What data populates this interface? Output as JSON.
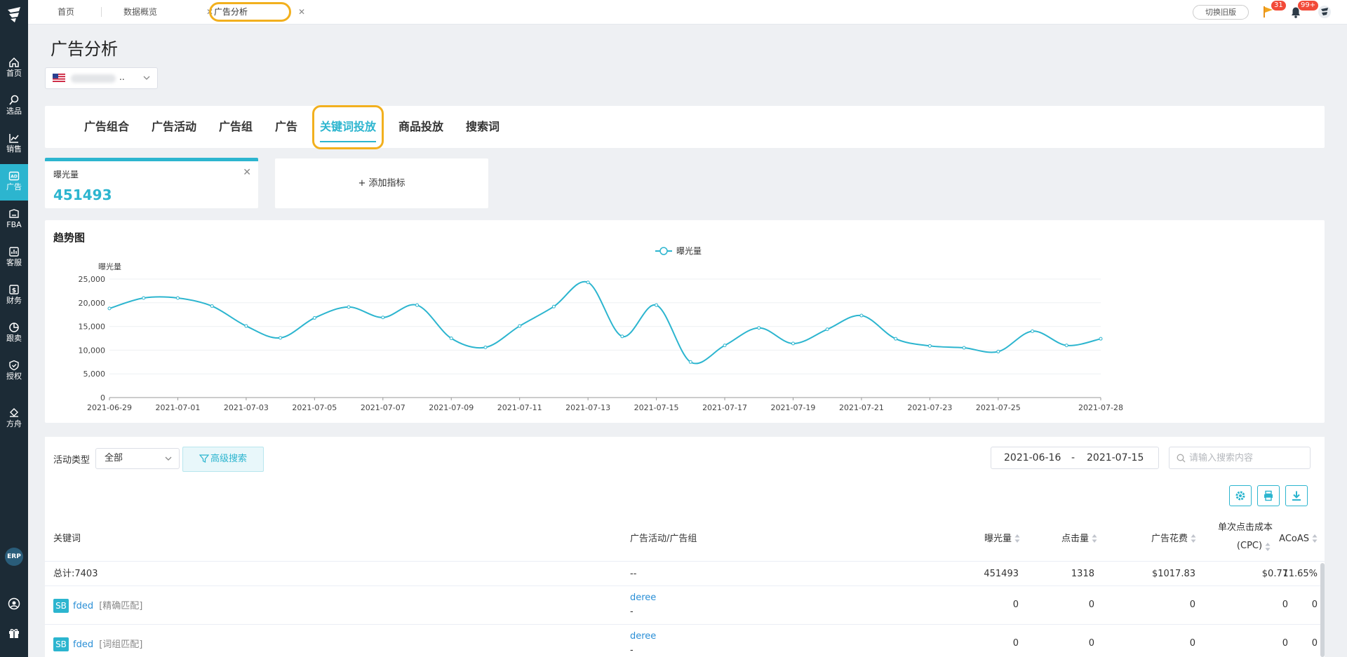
{
  "nav": {
    "items": [
      {
        "label": "首页",
        "icon": "home-icon",
        "active": false
      },
      {
        "label": "选品",
        "icon": "search-icon",
        "active": false
      },
      {
        "label": "销售",
        "icon": "chart-line-icon",
        "active": false
      },
      {
        "label": "广告",
        "icon": "ad-icon",
        "active": true
      },
      {
        "label": "FBA",
        "icon": "box-icon",
        "active": false
      },
      {
        "label": "客服",
        "icon": "bar-chart-icon",
        "active": false
      },
      {
        "label": "财务",
        "icon": "dollar-icon",
        "active": false
      },
      {
        "label": "跟卖",
        "icon": "pie-chart-icon",
        "active": false
      },
      {
        "label": "授权",
        "icon": "shield-icon",
        "active": false
      },
      {
        "label": "方舟",
        "icon": "ark-icon",
        "active": false
      }
    ],
    "erp_label": "ERP"
  },
  "topbar": {
    "tabs": [
      "首页",
      "数据概览",
      "广告分析"
    ],
    "old_version": "切换旧版",
    "flag_count": "31",
    "bell_count": "99+"
  },
  "page": {
    "title": "广告分析",
    "shop_suffix": ".."
  },
  "subtabs": [
    "广告组合",
    "广告活动",
    "广告组",
    "广告",
    "关键词投放",
    "商品投放",
    "搜索词"
  ],
  "metric": {
    "name": "曝光量",
    "value": "451493",
    "close": "✕"
  },
  "add_metric": "+ 添加指标",
  "trend": {
    "title": "趋势图"
  },
  "chart_data": {
    "type": "line",
    "title": "",
    "legend": "top-center",
    "ylabel": "曝光量",
    "ylim": [
      0,
      25000
    ],
    "yticks": [
      "25,000",
      "20,000",
      "15,000",
      "10,000",
      "5,000",
      "0"
    ],
    "xtick_labels": [
      "2021-06-29",
      "2021-07-01",
      "2021-07-03",
      "2021-07-05",
      "2021-07-07",
      "2021-07-09",
      "2021-07-11",
      "2021-07-13",
      "2021-07-15",
      "2021-07-17",
      "2021-07-19",
      "2021-07-21",
      "2021-07-23",
      "2021-07-25",
      "2021-07-28"
    ],
    "series": [
      {
        "name": "曝光量",
        "color": "#2cb5cf",
        "x": [
          "2021-06-29",
          "2021-06-30",
          "2021-07-01",
          "2021-07-02",
          "2021-07-03",
          "2021-07-04",
          "2021-07-05",
          "2021-07-06",
          "2021-07-07",
          "2021-07-08",
          "2021-07-09",
          "2021-07-10",
          "2021-07-11",
          "2021-07-12",
          "2021-07-13",
          "2021-07-14",
          "2021-07-15",
          "2021-07-16",
          "2021-07-17",
          "2021-07-18",
          "2021-07-19",
          "2021-07-20",
          "2021-07-21",
          "2021-07-22",
          "2021-07-23",
          "2021-07-24",
          "2021-07-25",
          "2021-07-26",
          "2021-07-27",
          "2021-07-28"
        ],
        "values": [
          18800,
          21000,
          21000,
          19300,
          15100,
          12600,
          16800,
          19100,
          16900,
          19500,
          12500,
          10600,
          15100,
          19200,
          24300,
          12900,
          19500,
          7500,
          11000,
          14700,
          11400,
          14400,
          17300,
          12400,
          10900,
          10500,
          9700,
          14000,
          11000,
          12400
        ]
      }
    ]
  },
  "filters": {
    "type_label": "活动类型",
    "type_value": "全部",
    "advanced": "高级搜索",
    "date_from": "2021-06-16",
    "date_sep": "-",
    "date_to": "2021-07-15",
    "search_placeholder": "请输入搜索内容"
  },
  "table": {
    "columns": [
      "关键词",
      "广告活动/广告组",
      "曝光量",
      "点击量",
      "广告花费",
      "单次点击成本",
      "(CPC)",
      "ACoAS"
    ],
    "total": {
      "label": "总计:7403",
      "campaign": "--",
      "impressions": "451493",
      "clicks": "1318",
      "spend": "$1017.83",
      "cpc": "$0.77",
      "acoas": "11.65%"
    },
    "rows": [
      {
        "type": "SB",
        "keyword": "fded",
        "match": "[精确匹配]",
        "campaign": "deree",
        "group": "-",
        "impressions": "0",
        "clicks": "0",
        "spend": "0",
        "cpc": "0",
        "acoas": "0"
      },
      {
        "type": "SB",
        "keyword": "fded",
        "match": "[词组匹配]",
        "campaign": "deree",
        "group": "-",
        "impressions": "0",
        "clicks": "0",
        "spend": "0",
        "cpc": "0",
        "acoas": "0"
      }
    ]
  }
}
